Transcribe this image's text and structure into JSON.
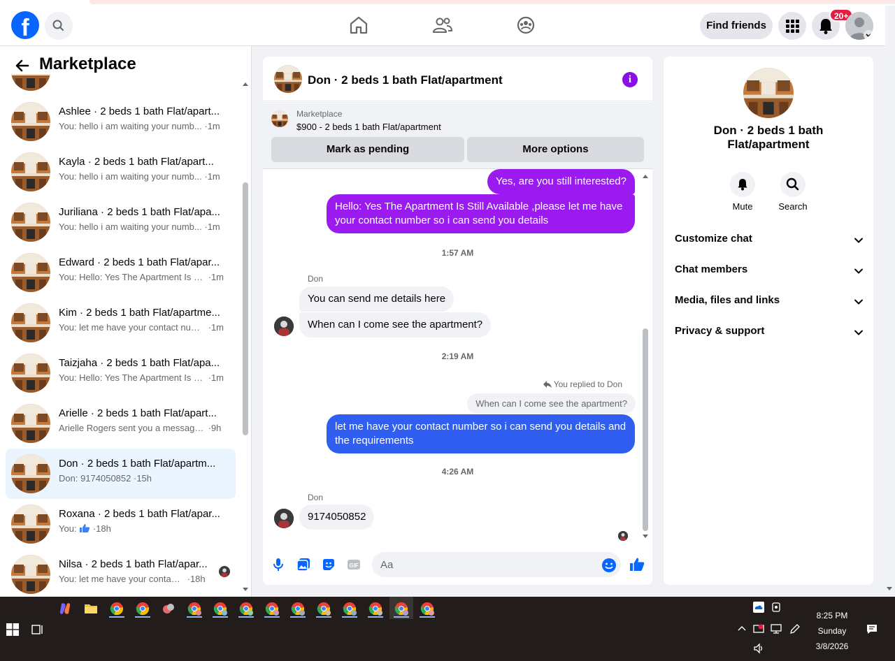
{
  "header": {
    "logo_letter": "f",
    "find_friends_label": "Find friends",
    "notification_badge": "20+",
    "nav_icons": [
      "home-icon",
      "friends-icon",
      "groups-icon"
    ]
  },
  "sidebar": {
    "title": "Marketplace",
    "conversations": [
      {
        "name": "Ashlee · 2 beds 1 bath Flat/apart...",
        "snippet": "You: hello i am waiting your numb...",
        "time": "·1m"
      },
      {
        "name": "Kayla · 2 beds 1 bath Flat/apart...",
        "snippet": "You: hello i am waiting your numb...",
        "time": "·1m"
      },
      {
        "name": "Juriliana · 2 beds 1 bath Flat/apa...",
        "snippet": "You: hello i am waiting your numb...",
        "time": "·1m"
      },
      {
        "name": "Edward · 2 beds 1 bath Flat/apar...",
        "snippet": "You: Hello: Yes The Apartment Is St...",
        "time": "·1m"
      },
      {
        "name": "Kim · 2 beds 1 bath Flat/apartme...",
        "snippet": "You: let me have your contact num...",
        "time": "·1m"
      },
      {
        "name": "Taizjaha · 2 beds 1 bath Flat/apa...",
        "snippet": "You: Hello: Yes The Apartment Is St...",
        "time": "·1m"
      },
      {
        "name": "Arielle · 2 beds 1 bath Flat/apart...",
        "snippet": "Arielle Rogers sent you a message ...",
        "time": "·9h"
      },
      {
        "name": "Don · 2 beds 1 bath Flat/apartm...",
        "snippet": "Don: 9174050852",
        "time": "·15h"
      },
      {
        "name": "Roxana · 2 beds 1 bath Flat/apar...",
        "snippet": "You:",
        "time": "·18h"
      },
      {
        "name": "Nilsa · 2 beds 1 bath Flat/apar...",
        "snippet": "You: let me have your contact n...",
        "time": "·18h"
      }
    ]
  },
  "chat": {
    "title": "Don · 2 beds 1 bath Flat/apartment",
    "marketplace_label": "Marketplace",
    "listing": "$900 - 2 beds 1 bath Flat/apartment",
    "mark_pending_label": "Mark as pending",
    "more_options_label": "More options",
    "messages": {
      "m1": "Yes, are you still interested?",
      "m2": "Hello: Yes The Apartment Is Still Available ,please let me have your contact number so i can send you details",
      "ts1": "1:57 AM",
      "sender1": "Don",
      "m3": "You can send me details here",
      "m4": "When can I come see the apartment?",
      "ts2": "2:19 AM",
      "reply_note": "You replied to Don",
      "quoted": "When can I come see the apartment?",
      "m5": "let me have your contact number so i can send you details and the requirements",
      "ts3": "4:26 AM",
      "sender2": "Don",
      "m6": "9174050852"
    },
    "composer_placeholder": "Aa"
  },
  "right_panel": {
    "name": "Don · 2 beds 1 bath Flat/apartment",
    "mute_label": "Mute",
    "search_label": "Search",
    "sections": [
      "Customize chat",
      "Chat members",
      "Media, files and links",
      "Privacy & support"
    ]
  },
  "taskbar": {
    "time": "8:25 PM",
    "day": "Sunday",
    "date": "3/8/2026"
  },
  "colors": {
    "brand_blue": "#0866ff",
    "outgoing_purple": "#9a1af0",
    "outgoing_blue": "#2f5ef0",
    "badge_red": "#e41e3f"
  }
}
